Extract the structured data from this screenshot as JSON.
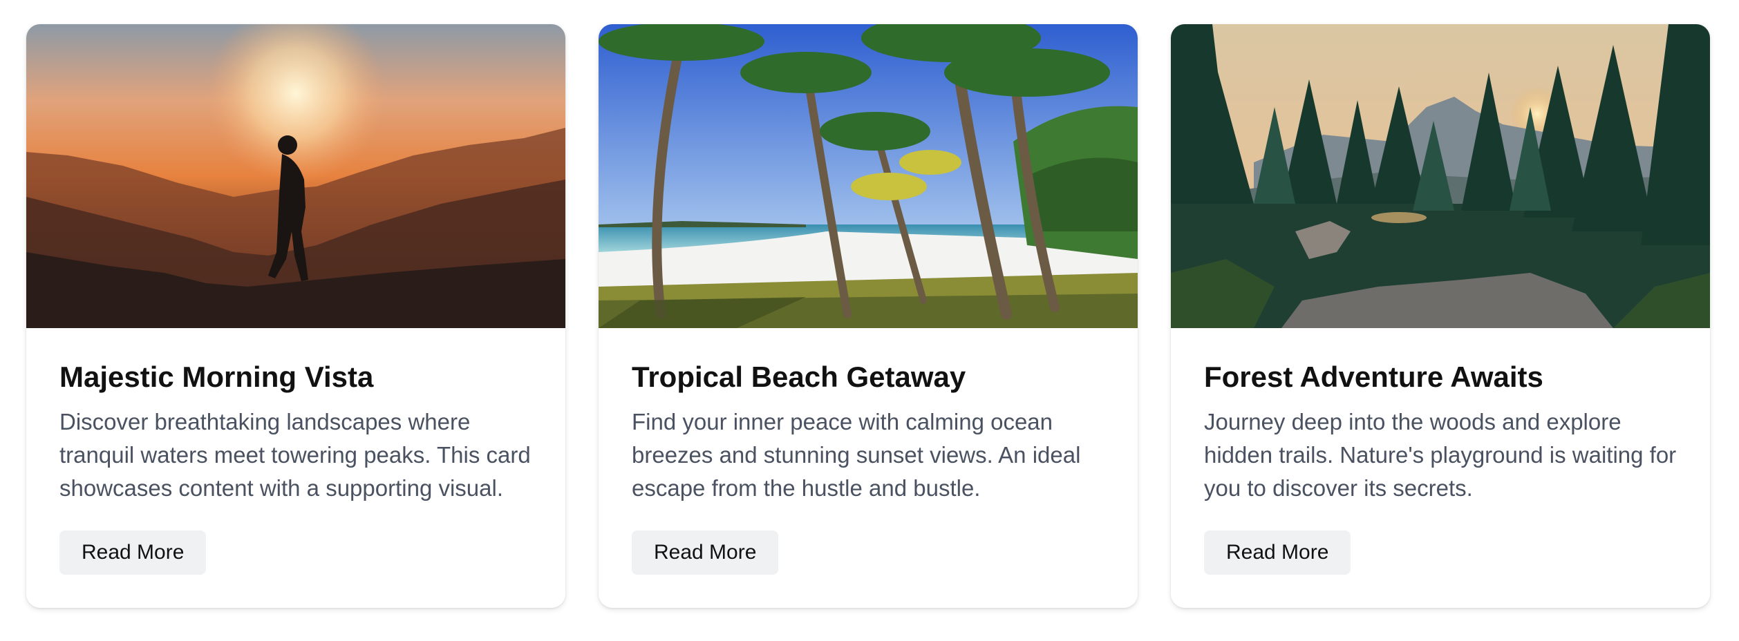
{
  "cards": [
    {
      "image_alt": "Silhouette of a hiker on a mountain at sunrise",
      "title": "Majestic Morning Vista",
      "description": "Discover breathtaking landscapes where tranquil waters meet towering peaks. This card showcases content with a supporting visual.",
      "button_label": "Read More"
    },
    {
      "image_alt": "Palm trees on a white sand tropical beach",
      "title": "Tropical Beach Getaway",
      "description": "Find your inner peace with calming ocean breezes and stunning sunset views. An ideal escape from the hustle and bustle.",
      "button_label": "Read More"
    },
    {
      "image_alt": "Pine forest and mountains at sunset with rocky ledge",
      "title": "Forest Adventure Awaits",
      "description": "Journey deep into the woods and explore hidden trails. Nature's playground is waiting for you to discover its secrets.",
      "button_label": "Read More"
    }
  ]
}
